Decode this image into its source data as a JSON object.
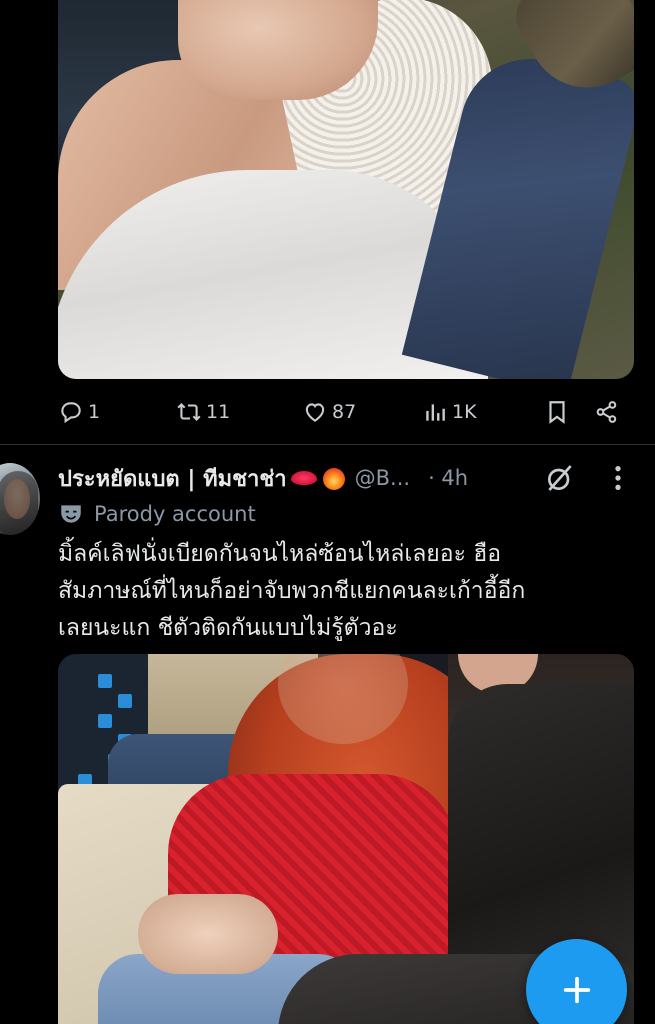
{
  "previous_tweet": {
    "actions": {
      "reply_count": "1",
      "retweet_count": "11",
      "like_count": "87",
      "view_count": "1K"
    }
  },
  "tweet": {
    "display_name": "ประหยัดแบต | ทีมชาช่า",
    "handle": "@B...",
    "time": "· 4h",
    "parody_label": "Parody account",
    "text_lines": [
      "มิ้ลค์เลิฟนั่งเบียดกันจนไหล่ซ้อนไหล่เลยอะ ฮือ",
      "สัมภาษณ์ที่ไหนก็อย่าจับพวกชีแยกคนละเก้าอี้อีก",
      "เลยนะแก ชีตัวติดกันแบบไม่รู้ตัวอะ"
    ]
  },
  "icons": {
    "reply": "reply-icon",
    "retweet": "retweet-icon",
    "like": "heart-icon",
    "views": "views-icon",
    "bookmark": "bookmark-icon",
    "share": "share-icon",
    "grok": "grok-icon",
    "more": "more-icon",
    "parody": "mask-icon",
    "compose": "plus-icon"
  },
  "colors": {
    "background": "#000000",
    "text_primary": "#e7e9ea",
    "text_secondary": "#8b98a5",
    "accent": "#1d9bf0",
    "divider": "#2f3336"
  }
}
